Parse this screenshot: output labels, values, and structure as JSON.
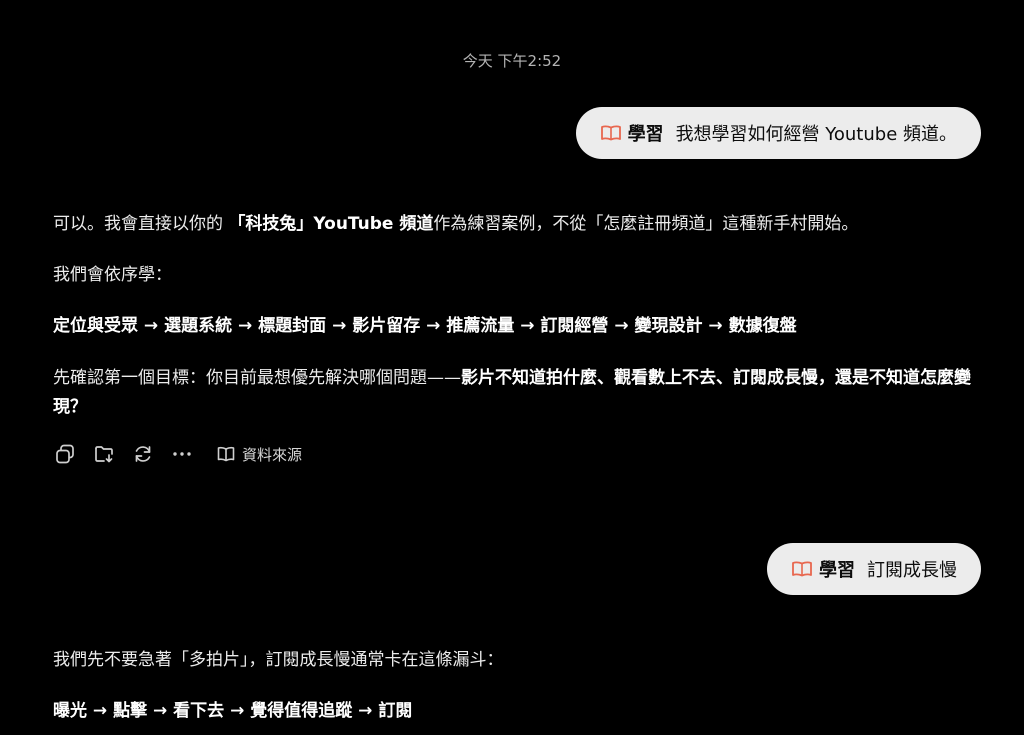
{
  "conversation": {
    "timestamp": "今天 下午2:52",
    "user_messages": [
      {
        "tag": "學習",
        "text": "我想學習如何經營 Youtube 頻道。"
      },
      {
        "tag": "學習",
        "text": "訂閱成長慢"
      }
    ],
    "assistant_message_1": {
      "p1_a": "可以。我會直接以你的 ",
      "p1_b": "「科技兔」YouTube 頻道",
      "p1_c": "作為練習案例，不從「怎麼註冊頻道」這種新手村開始。",
      "p2": "我們會依序學：",
      "p3": "定位與受眾 → 選題系統 → 標題封面 → 影片留存 → 推薦流量 → 訂閱經營 → 變現設計 → 數據復盤",
      "p4_a": "先確認第一個目標：你目前最想優先解決哪個問題——",
      "p4_b": "影片不知道拍什麼、觀看數上不去、訂閱成長慢，還是不知道怎麼變現？"
    },
    "actions": {
      "copy_icon": "copy-icon",
      "save_icon": "folder-download-icon",
      "regenerate_icon": "refresh-icon",
      "more_icon": "ellipsis-icon",
      "sources_icon": "book-open-icon",
      "sources_label": "資料來源"
    },
    "assistant_message_2": {
      "p1": "我們先不要急著「多拍片」，訂閱成長慢通常卡在這條漏斗：",
      "p2": "曝光 → 點擊 → 看下去 → 覺得值得追蹤 → 訂閱"
    }
  },
  "colors": {
    "background": "#000000",
    "bubble": "#ececec",
    "text": "#ececec",
    "book_icon": "#e8674f",
    "muted": "#b4b4b4"
  }
}
